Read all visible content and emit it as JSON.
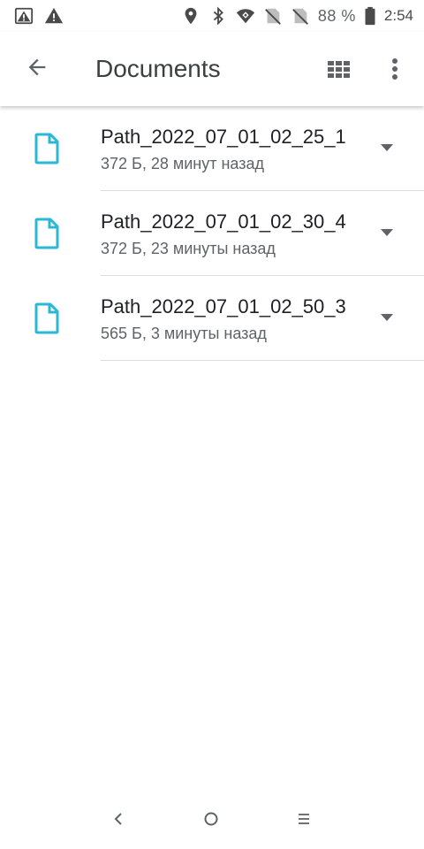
{
  "status_bar": {
    "left_icons": [
      "image-warning-icon",
      "warning-icon"
    ],
    "right_icons": [
      "location-icon",
      "bluetooth-icon",
      "wifi-icon",
      "no-sim-icon",
      "no-sim-icon",
      "battery-icon"
    ],
    "battery_percent": "88 %",
    "time": "2:54"
  },
  "app_bar": {
    "title": "Documents",
    "back_icon": "arrow-back-icon",
    "view_icon": "grid-view-icon",
    "more_icon": "more-vert-icon"
  },
  "files": [
    {
      "name": "Path_2022_07_01_02_25_1",
      "meta": "372 Б, 28 минут назад",
      "icon": "file-icon"
    },
    {
      "name": "Path_2022_07_01_02_30_4",
      "meta": "372 Б, 23 минуты назад",
      "icon": "file-icon"
    },
    {
      "name": "Path_2022_07_01_02_50_3",
      "meta": "565 Б, 3 минуты назад",
      "icon": "file-icon"
    }
  ],
  "colors": {
    "file_icon": "#2bb8d4",
    "title": "#3c4043",
    "meta": "#5f6368",
    "divider": "#dadce0"
  },
  "nav_bar": {
    "back_icon": "nav-back-icon",
    "home_icon": "nav-home-icon",
    "recents_icon": "nav-recents-icon"
  }
}
